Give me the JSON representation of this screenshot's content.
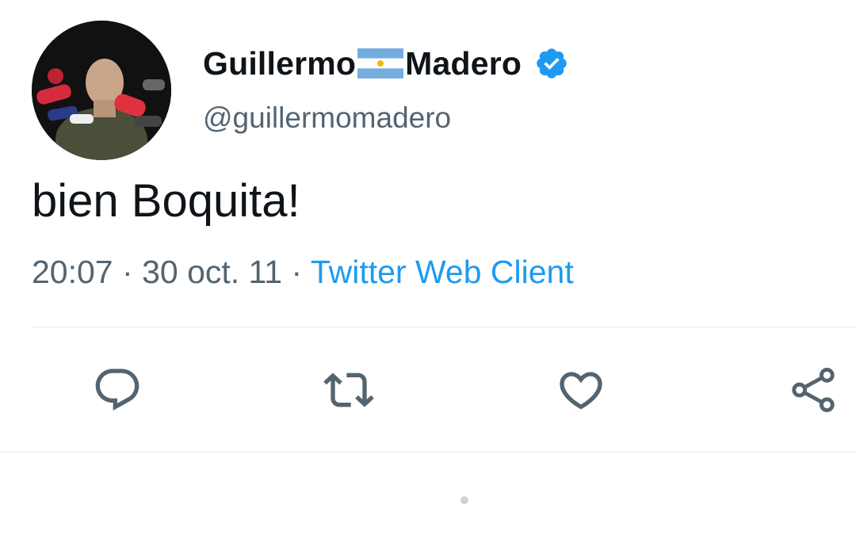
{
  "tweet": {
    "author": {
      "name_first": "Guillermo",
      "name_last": "Madero",
      "handle": "@guillermomadero",
      "avatar_icon": "profile-photo",
      "flag_icon": "argentina-flag-icon",
      "verified_icon": "verified-badge-icon"
    },
    "text": "bien Boquita!",
    "time": "20:07",
    "separator": "·",
    "date": "30 oct. 11",
    "client": "Twitter Web Client"
  },
  "actions": {
    "reply_icon": "reply-icon",
    "retweet_icon": "retweet-icon",
    "like_icon": "like-icon",
    "share_icon": "share-icon"
  },
  "colors": {
    "text_primary": "#0f1419",
    "text_secondary": "#536471",
    "accent": "#1d9bf0",
    "divider": "#e6e9eb"
  }
}
